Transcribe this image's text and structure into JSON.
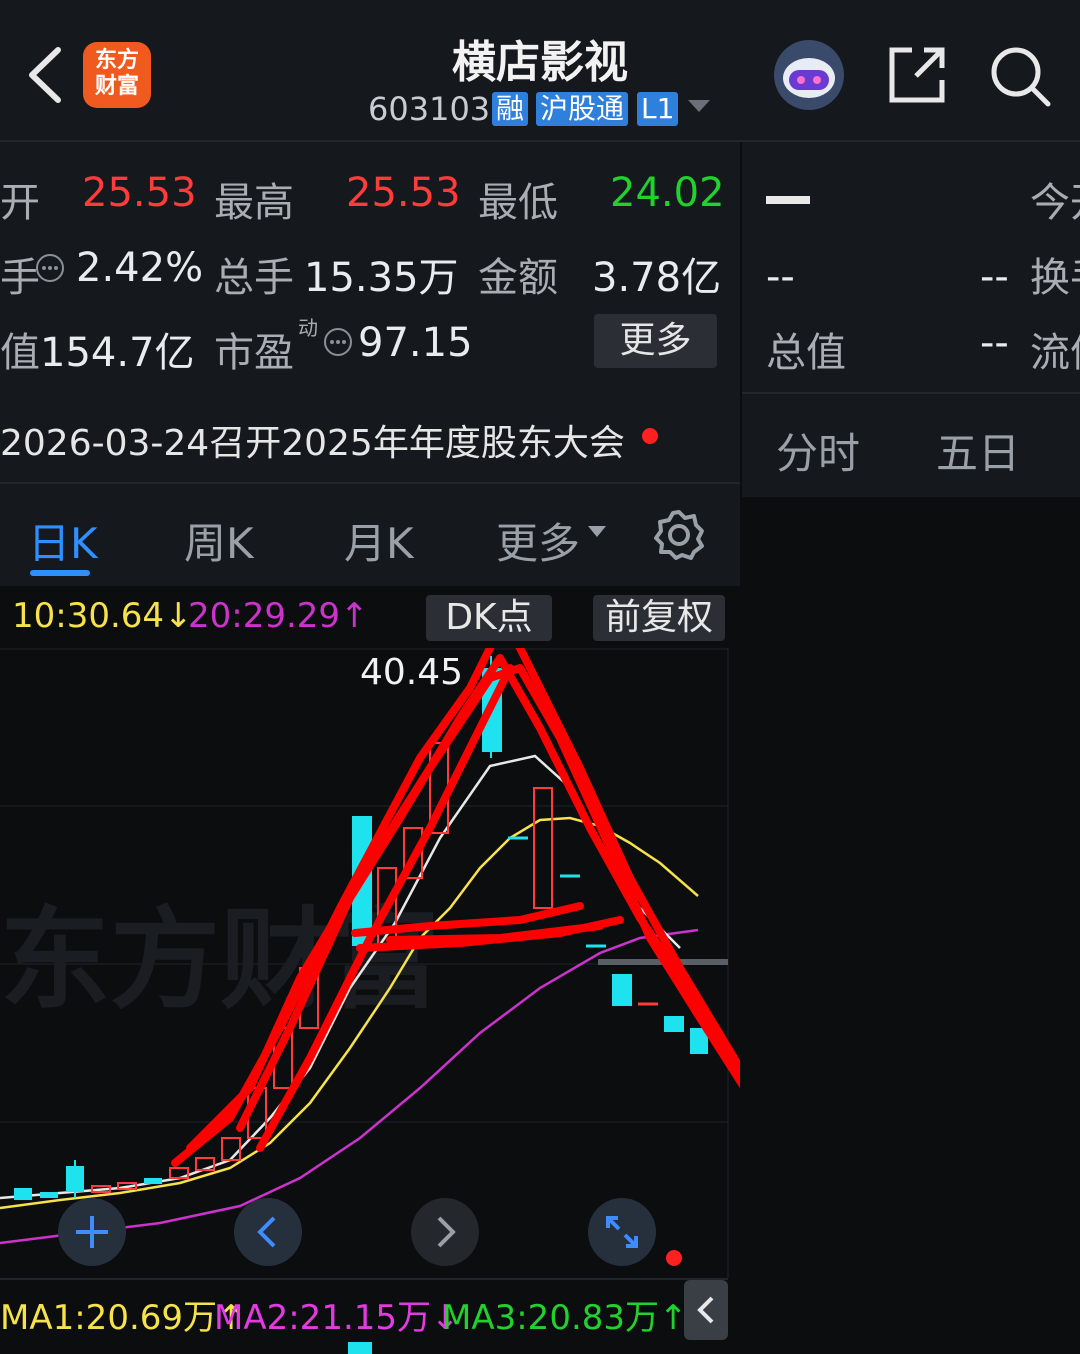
{
  "header": {
    "back_icon": "chevron-left-icon",
    "app_logo_text": "东方\n财富",
    "title": "横店影视",
    "code": "603103",
    "tags": [
      "融",
      "沪股通",
      "L1"
    ],
    "avatar_icon": "robot-avatar-icon",
    "share_icon": "share-icon",
    "search_icon": "search-icon"
  },
  "quote": {
    "row1": {
      "l1": "开",
      "v1": "25.53",
      "l2": "最高",
      "v2": "25.53",
      "l3": "最低",
      "v3": "24.02"
    },
    "row2": {
      "l1": "手",
      "v1": "2.42%",
      "l2": "总手",
      "v2": "15.35万",
      "l3": "金额",
      "v3": "3.78亿"
    },
    "row3": {
      "l1": "值",
      "v1": "154.7亿",
      "l2": "市盈",
      "sup": "动",
      "v2": "97.15",
      "more": "更多"
    }
  },
  "right_panel": {
    "top_dash": "—",
    "top_label": "今开",
    "row2_a": "--",
    "row2_b": "--",
    "row2_label": "换手",
    "row3_label": "总值",
    "row3_val": "--",
    "row3_label2": "流值",
    "tabs": [
      "分时",
      "五日"
    ]
  },
  "announcement": "2026-03-24召开2025年年度股东大会",
  "ktabs": {
    "active": "日K",
    "items": [
      "日K",
      "周K",
      "月K",
      "更多"
    ]
  },
  "legend": {
    "ma1": "10:30.64",
    "ma1_arrow": "↓",
    "ma2": "20:29.29",
    "ma2_arrow": "↑",
    "dk": "DK点",
    "adjust": "前复权"
  },
  "chart": {
    "peak_label": "40.45",
    "watermark": "东方财富"
  },
  "bottom_ma": {
    "ma1": "MA1:20.69万",
    "ma1_arrow": "↑",
    "ma2": "MA2:21.15万",
    "ma2_arrow": "↓",
    "ma3": "MA3:20.83万",
    "ma3_arrow": "↑"
  },
  "colors": {
    "up": "#ff3b3b",
    "down": "#1ee3ee",
    "ma10": "#f6e24a",
    "ma20": "#cc33cc",
    "accent": "#2f7fdc"
  }
}
